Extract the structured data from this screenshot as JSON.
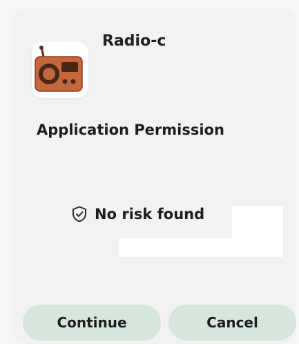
{
  "app": {
    "name": "Radio-c",
    "icon": "radio-icon"
  },
  "permission": {
    "title": "Application Permission",
    "status_icon": "shield-check-icon",
    "status": "No risk found"
  },
  "actions": {
    "continue_label": "Continue",
    "cancel_label": "Cancel"
  },
  "colors": {
    "button_bg": "#d6e6dd",
    "radio_body": "#c4673a",
    "radio_dark": "#5a2f1e",
    "dialog_bg": "#f1f2f1"
  }
}
